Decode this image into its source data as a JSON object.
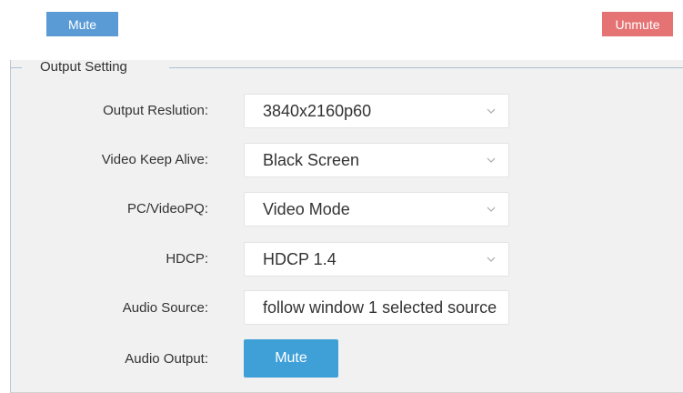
{
  "top_bar": {
    "mute_label": "Mute",
    "unmute_label": "Unmute"
  },
  "output_setting": {
    "legend": "Output Setting",
    "rows": [
      {
        "label": "Output Reslution:",
        "value": "3840x2160p60"
      },
      {
        "label": "Video Keep Alive:",
        "value": "Black Screen"
      },
      {
        "label": "PC/VideoPQ:",
        "value": "Video Mode"
      },
      {
        "label": "HDCP:",
        "value": "HDCP 1.4"
      },
      {
        "label": "Audio Source:",
        "value": "follow window 1 selected source"
      },
      {
        "label": "Audio Output:",
        "button": "Mute"
      }
    ]
  },
  "colors": {
    "mute_top": "#5b9bd5",
    "unmute_top": "#e57373",
    "mute_button": "#3fa0d8",
    "panel_bg": "#f1f1f1"
  },
  "icons": {
    "dropdown": "chevron-down-icon"
  }
}
